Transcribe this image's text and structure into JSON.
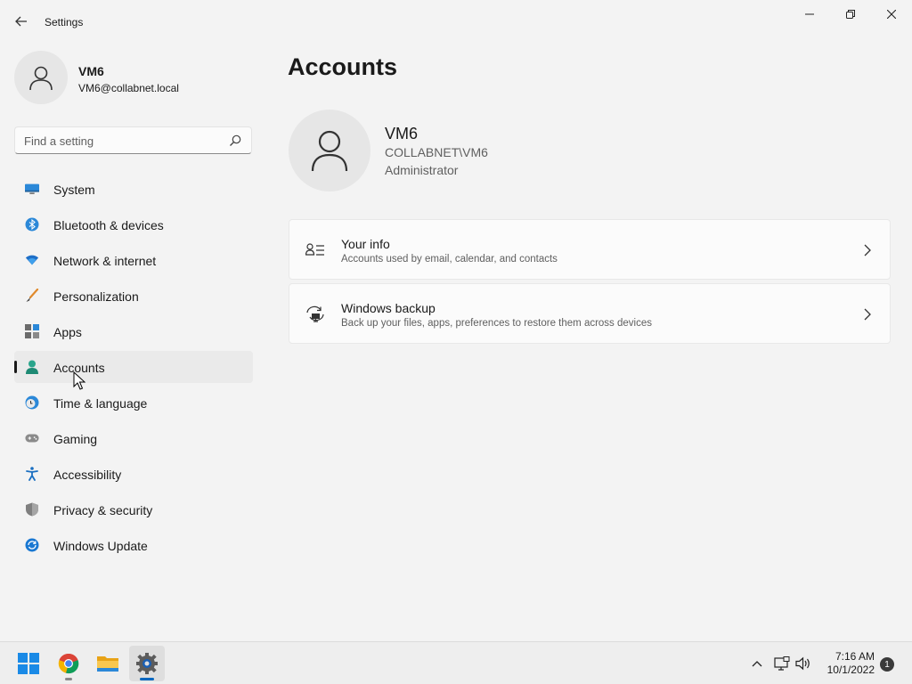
{
  "window": {
    "title": "Settings",
    "back_icon": "back-arrow-icon",
    "controls": [
      "minimize-icon",
      "restore-icon",
      "close-icon"
    ]
  },
  "profile": {
    "name": "VM6",
    "email": "VM6@collabnet.local"
  },
  "search": {
    "placeholder": "Find a setting",
    "value": ""
  },
  "nav": {
    "items": [
      {
        "label": "System",
        "icon": "system-display-icon"
      },
      {
        "label": "Bluetooth & devices",
        "icon": "bluetooth-icon"
      },
      {
        "label": "Network & internet",
        "icon": "wifi-icon"
      },
      {
        "label": "Personalization",
        "icon": "brush-icon"
      },
      {
        "label": "Apps",
        "icon": "apps-icon"
      },
      {
        "label": "Accounts",
        "icon": "person-icon",
        "selected": true
      },
      {
        "label": "Time & language",
        "icon": "clock-globe-icon"
      },
      {
        "label": "Gaming",
        "icon": "gamepad-icon"
      },
      {
        "label": "Accessibility",
        "icon": "accessibility-icon"
      },
      {
        "label": "Privacy & security",
        "icon": "shield-icon"
      },
      {
        "label": "Windows Update",
        "icon": "update-icon"
      }
    ]
  },
  "main": {
    "title": "Accounts",
    "account": {
      "name": "VM6",
      "domain": "COLLABNET\\VM6",
      "role": "Administrator"
    },
    "cards": [
      {
        "title": "Your info",
        "subtitle": "Accounts used by email, calendar, and contacts",
        "icon": "contact-info-icon"
      },
      {
        "title": "Windows backup",
        "subtitle": "Back up your files, apps, preferences to restore them across devices",
        "icon": "backup-sync-icon"
      }
    ]
  },
  "taskbar": {
    "apps": [
      {
        "name": "Start",
        "icon": "windows-start-icon"
      },
      {
        "name": "Google Chrome",
        "icon": "chrome-icon",
        "running": true
      },
      {
        "name": "File Explorer",
        "icon": "folder-icon"
      },
      {
        "name": "Settings",
        "icon": "settings-gear-icon",
        "running": true,
        "active": true
      }
    ],
    "tray": {
      "icons": [
        "chevron-up-icon",
        "network-icon",
        "volume-icon"
      ],
      "time": "7:16 AM",
      "date": "10/1/2022",
      "notification_count": "1"
    }
  },
  "colors": {
    "background": "#f3f3f3",
    "accent": "#0067c0",
    "card": "#fbfbfb"
  }
}
